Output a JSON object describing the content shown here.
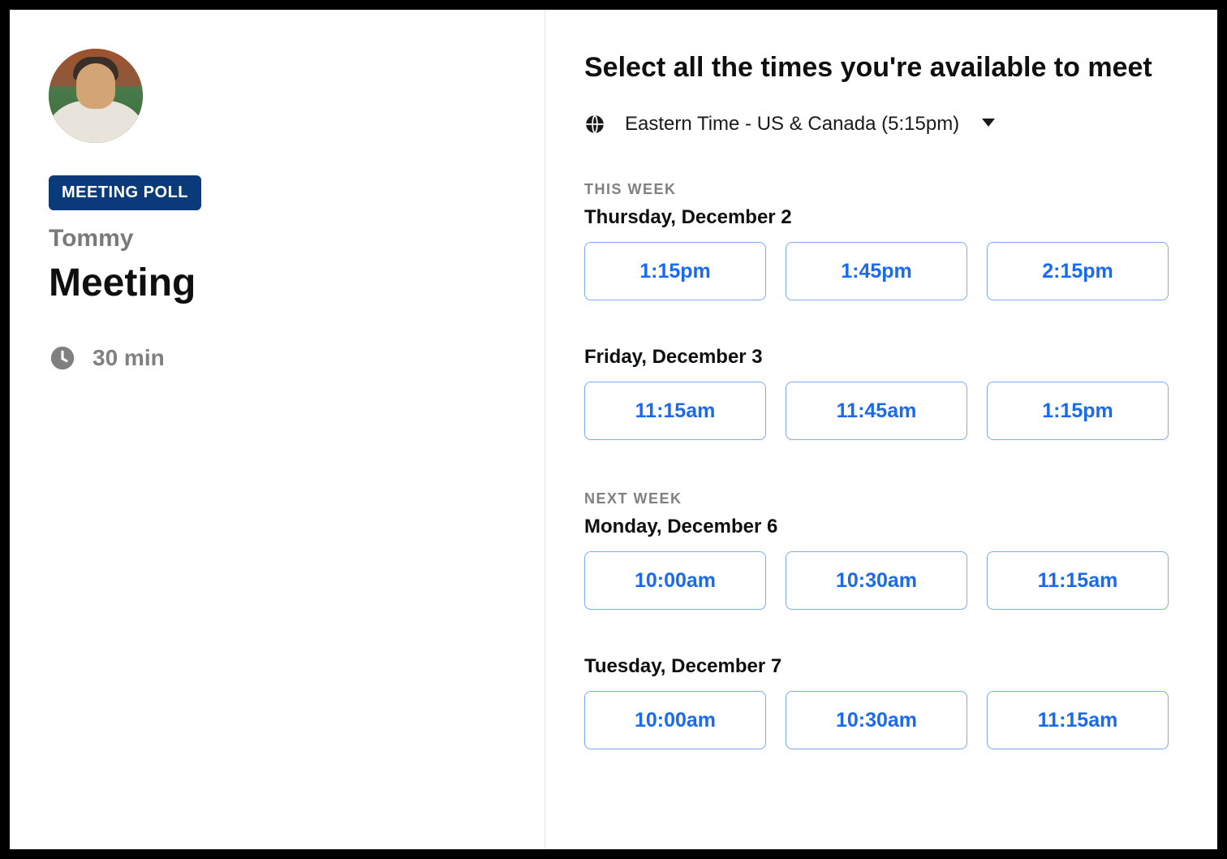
{
  "sidebar": {
    "badge": "MEETING POLL",
    "host": "Tommy",
    "title": "Meeting",
    "duration": "30 min"
  },
  "main": {
    "heading": "Select all the times you're available to meet",
    "timezone": "Eastern Time - US & Canada (5:15pm)",
    "groups": [
      {
        "weekLabel": "THIS WEEK",
        "days": [
          {
            "date": "Thursday, December 2",
            "slots": [
              "1:15pm",
              "1:45pm",
              "2:15pm"
            ]
          },
          {
            "date": "Friday, December 3",
            "slots": [
              "11:15am",
              "11:45am",
              "1:15pm"
            ]
          }
        ]
      },
      {
        "weekLabel": "NEXT WEEK",
        "days": [
          {
            "date": "Monday, December 6",
            "slots": [
              "10:00am",
              "10:30am",
              "11:15am"
            ]
          },
          {
            "date": "Tuesday, December 7",
            "slots": [
              "10:00am",
              "10:30am",
              "11:15am"
            ]
          }
        ]
      }
    ]
  }
}
